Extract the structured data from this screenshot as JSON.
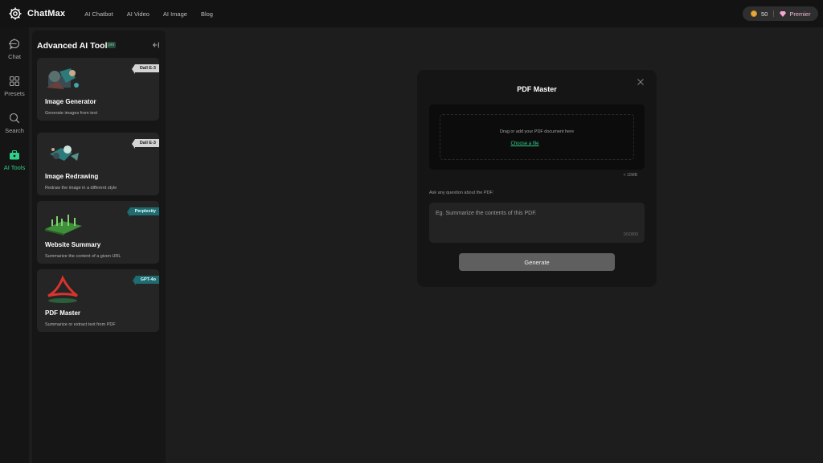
{
  "header": {
    "app_name": "ChatMax",
    "nav": [
      "AI Chatbot",
      "AI Video",
      "AI Image",
      "Blog"
    ],
    "coins": "50",
    "plan": "Premier"
  },
  "rail": {
    "items": [
      {
        "label": "Chat",
        "icon": "chat-bubble-icon"
      },
      {
        "label": "Presets",
        "icon": "grid-icon"
      },
      {
        "label": "Search",
        "icon": "search-icon"
      },
      {
        "label": "AI Tools",
        "icon": "toolbox-icon",
        "active": true
      }
    ]
  },
  "panel": {
    "title": "Advanced AI Tools",
    "pro_badge": "pro",
    "cards": [
      {
        "title": "Image Generator",
        "desc": "Generate images from text",
        "tag": "Dall E-3",
        "tag_style": "dall"
      },
      {
        "title": "Image Redrawing",
        "desc": "Redraw the image in a different style",
        "tag": "Dall E-3",
        "tag_style": "dall"
      },
      {
        "title": "Website Summary",
        "desc": "Summarize the content of a given URL",
        "tag": "Perplexity",
        "tag_style": "teal"
      },
      {
        "title": "PDF Master",
        "desc": "Summarize or extract text from PDF",
        "tag": "GPT-4o",
        "tag_style": "teal"
      }
    ]
  },
  "modal": {
    "title": "PDF Master",
    "upload_hint": "Drag or add your PDF document here",
    "choose_file": "Choose a file",
    "size_note": "< 10MB",
    "question_label": "Ask any question about the PDF:",
    "question_placeholder": "Eg. Summarize the contents of this PDF.",
    "char_count": "0/10000",
    "generate_label": "Generate"
  },
  "colors": {
    "accent": "#2fd08a",
    "background": "#1d1d1d",
    "panel": "#161616",
    "card": "#252525"
  }
}
